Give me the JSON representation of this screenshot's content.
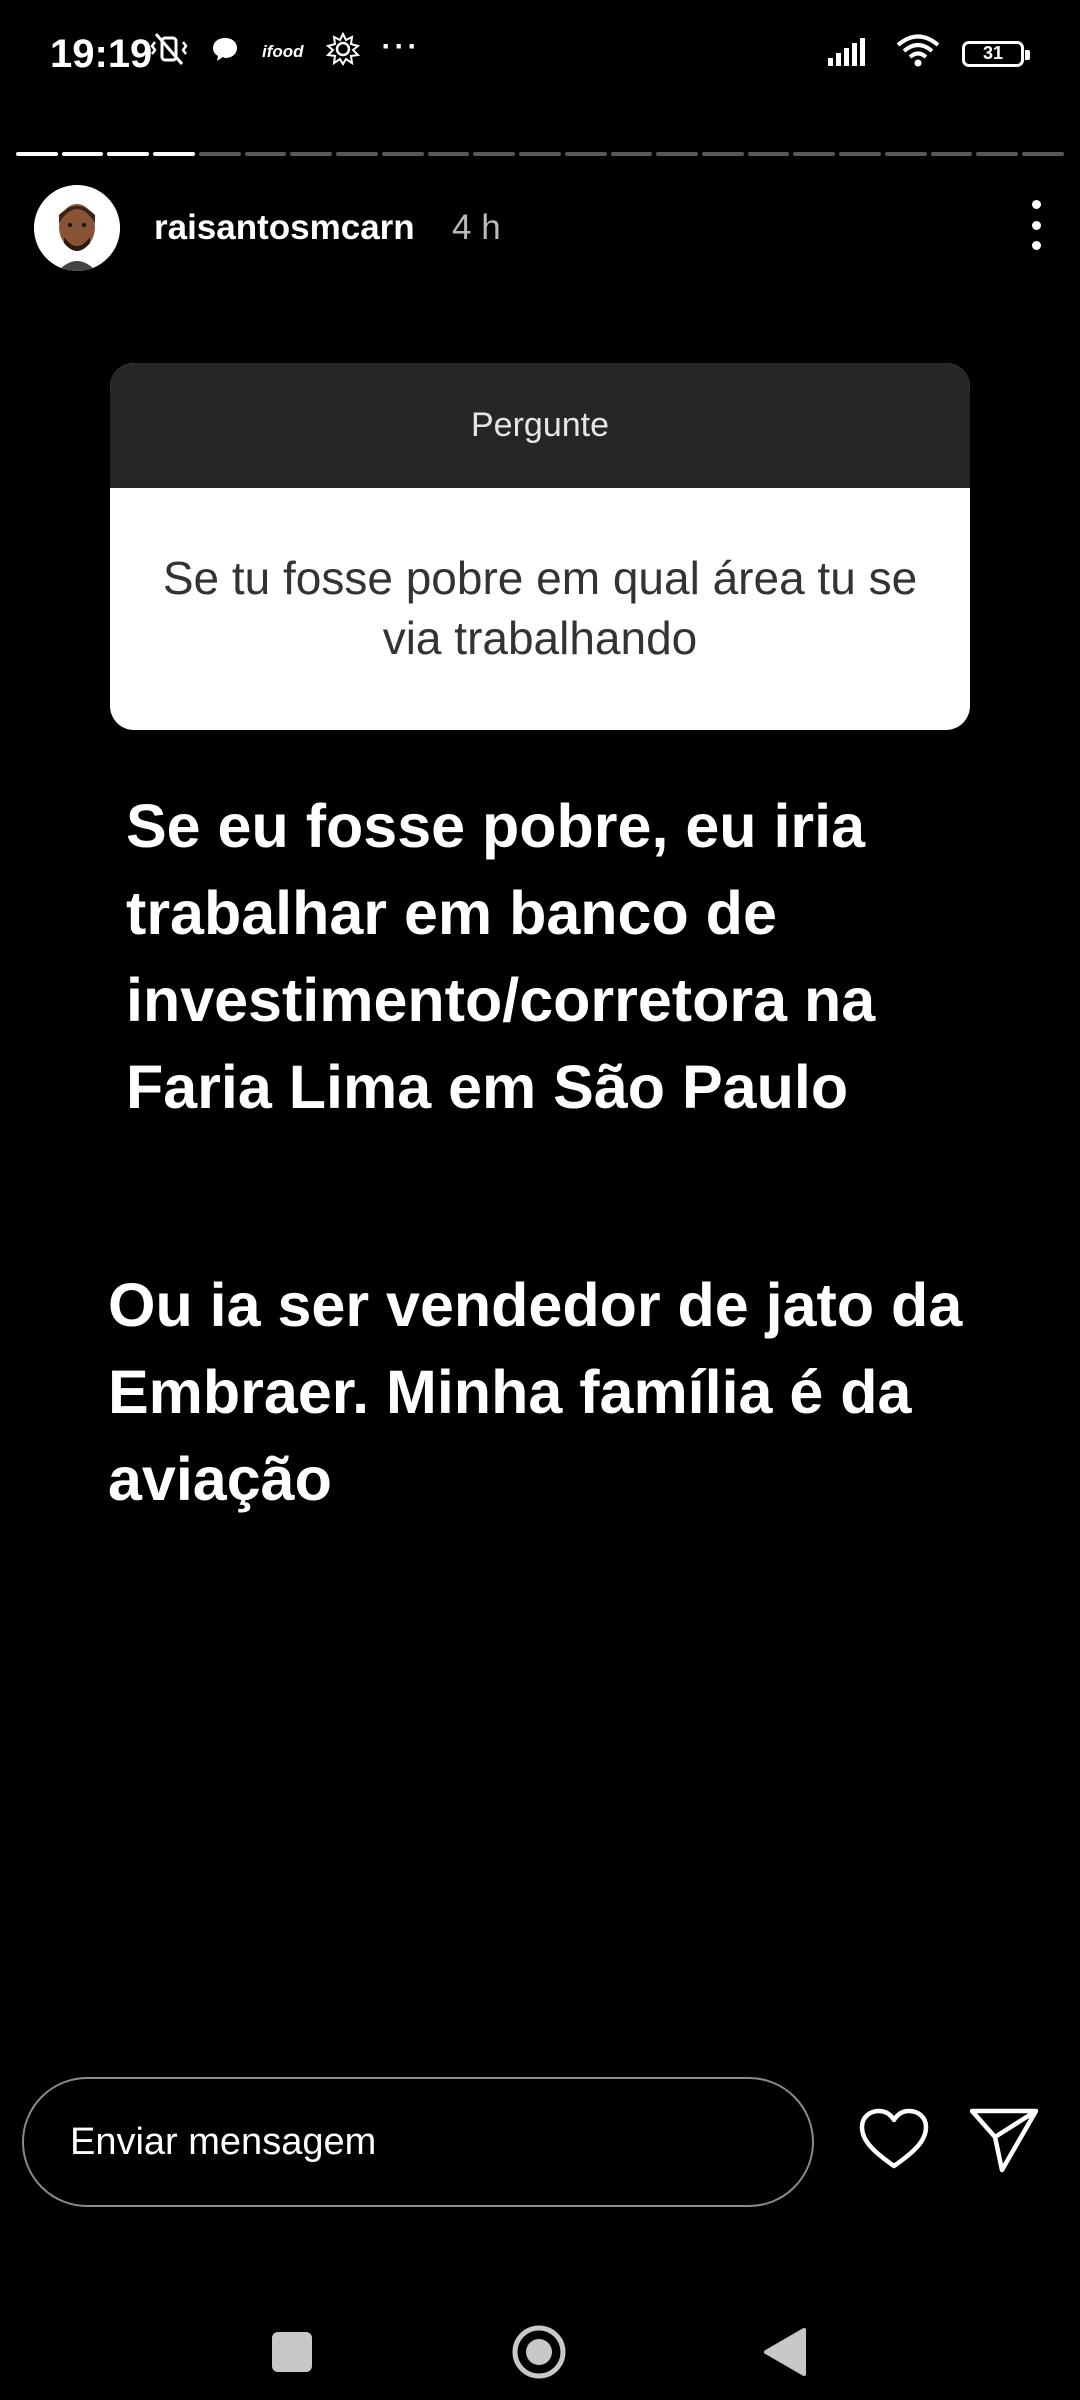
{
  "status_bar": {
    "time": "19:19",
    "ifood_label": "ifood",
    "more": "···",
    "battery": "31"
  },
  "story": {
    "progress": {
      "total_segments": 23,
      "completed_segments": 4
    },
    "username": "raisantosmcarn",
    "age": "4 h"
  },
  "question_sticker": {
    "title": "Pergunte",
    "question": "Se tu fosse pobre em qual área tu se via trabalhando"
  },
  "answer": {
    "paragraph_1": "Se eu fosse pobre, eu iria trabalhar em banco de investimento/corretora na Faria Lima em São Paulo",
    "paragraph_2": "Ou ia ser vendedor de jato da Embraer. Minha família é da aviação"
  },
  "reply_bar": {
    "placeholder": "Enviar mensagem"
  },
  "icons": {
    "like": "heart-icon",
    "send": "send-icon",
    "menu": "more-vertical-icon"
  },
  "colors": {
    "background": "#000000",
    "sticker_header": "#262626",
    "sticker_body": "#ffffff"
  }
}
